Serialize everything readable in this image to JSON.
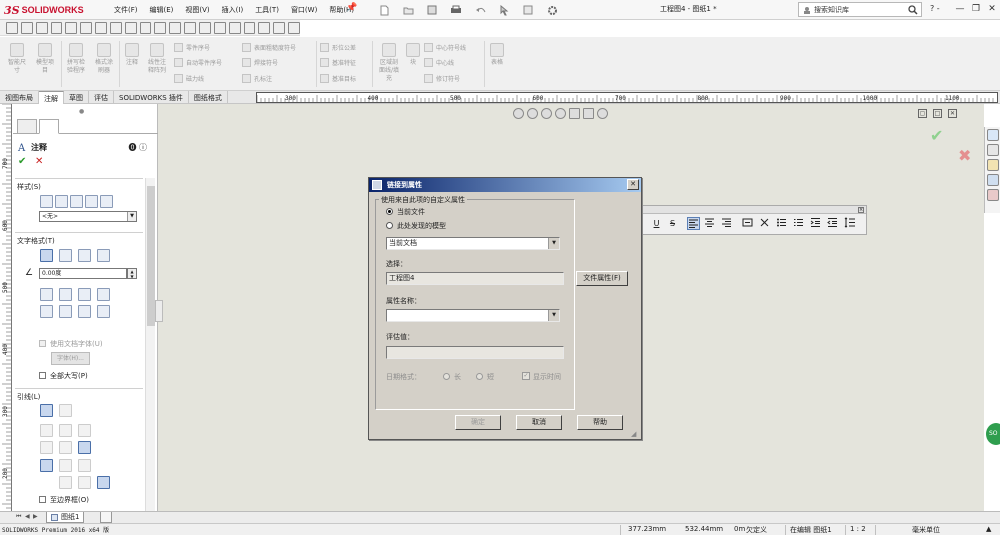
{
  "app": {
    "brand_mark": "3S",
    "brand_name": "SOLIDWORKS"
  },
  "menu": [
    "文件(F)",
    "编辑(E)",
    "视图(V)",
    "插入(I)",
    "工具(T)",
    "窗口(W)",
    "帮助(H)"
  ],
  "document_title": "工程图4 - 图纸1 *",
  "search": {
    "placeholder": "搜索知识库"
  },
  "help_label": "? -",
  "window_controls": [
    "—",
    "❐",
    "✕"
  ],
  "ribbon": {
    "big": [
      {
        "label": "智能尺\n寸"
      },
      {
        "label": "模型项\n目"
      },
      {
        "label": "拼写检\n验程序"
      },
      {
        "label": "格式涂\n刷器"
      },
      {
        "label": "注释"
      },
      {
        "label": "线性注\n释阵列"
      },
      {
        "label": "区域剖\n面线/填\n充"
      },
      {
        "label": "块"
      },
      {
        "label": "表格"
      }
    ],
    "small": [
      "零件序号",
      "自动零件序号",
      "磁力线",
      "表面粗糙度符号",
      "焊接符号",
      "孔标注",
      "形位公差",
      "基准特征",
      "基准目标",
      "中心符号线",
      "中心线",
      "修订符号"
    ]
  },
  "tabs": [
    "视图布局",
    "注解",
    "草图",
    "评估",
    "SOLIDWORKS 插件",
    "图纸格式"
  ],
  "active_tab": "注解",
  "ruler_labels": [
    "300",
    "400",
    "500",
    "600",
    "700",
    "800",
    "900",
    "1000",
    "1100"
  ],
  "vruler_labels": [
    "700",
    "600",
    "500",
    "400",
    "300",
    "200",
    "100"
  ],
  "property_manager": {
    "title": "注释",
    "help_icons": "?",
    "ok": "✔",
    "cancel": "✕",
    "style_group": "样式(S)",
    "style_value": "<无>",
    "text_format_group": "文字格式(T)",
    "angle_value": "0.00度",
    "use_doc_font": "使用文档字体(U)",
    "font_button": "字体(H)...",
    "all_caps": "全部大写(P)",
    "leader_group": "引线(L)",
    "to_border": "至边界框(O)"
  },
  "format_toolbar": {
    "buttons": [
      "U",
      "S"
    ]
  },
  "dialog": {
    "title": "链接到属性",
    "close": "✕",
    "group_label": "使用来自此项的自定义属性",
    "radio_current": "当前文件",
    "radio_model": "此处发现的模型",
    "source_value": "当前文档",
    "select_label": "选择：",
    "select_value": "工程图4",
    "file_props_button": "文件属性(F)",
    "prop_name_label": "属性名称：",
    "prop_name_value": "",
    "eval_label": "评估值：",
    "eval_value": "",
    "date_format_label": "日期格式：",
    "date_long": "长",
    "date_short": "短",
    "show_time": "显示时间",
    "ok_button": "确定",
    "cancel_button": "取消",
    "help_button": "帮助"
  },
  "sheet_tab": "图纸1",
  "status": {
    "app_version": "SOLIDWORKS Premium 2016 x64 版",
    "x": "377.23mm",
    "y": "532.44mm",
    "z": "0m",
    "defined": "欠定义",
    "editing": "在编辑 图纸1",
    "scale": "1 : 2",
    "units": "毫米单位"
  },
  "colors": {
    "accent": "#0a246a",
    "brand_red": "#c8102e",
    "ok_green": "#2c9b2c"
  }
}
